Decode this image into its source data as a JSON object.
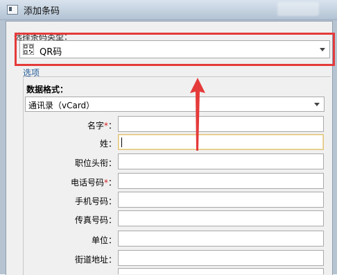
{
  "window": {
    "title": "添加条码"
  },
  "barcode_type": {
    "label": "选择条码类型：",
    "selected": "QR码",
    "icon": "qr-code-icon"
  },
  "options": {
    "section_label": "选项",
    "format_label": "数据格式：",
    "format_selected": "通讯录（vCard）",
    "fields": [
      {
        "label": "名字",
        "required": "*",
        "suffix": "：",
        "value": ""
      },
      {
        "label": "姓",
        "required": "",
        "suffix": "：",
        "value": ""
      },
      {
        "label": "职位头衔",
        "required": "",
        "suffix": "：",
        "value": ""
      },
      {
        "label": "电话号码",
        "required": "*",
        "suffix": "：",
        "value": ""
      },
      {
        "label": "手机号码",
        "required": "",
        "suffix": "：",
        "value": ""
      },
      {
        "label": "传真号码",
        "required": "",
        "suffix": "：",
        "value": ""
      },
      {
        "label": "单位",
        "required": "",
        "suffix": "：",
        "value": ""
      },
      {
        "label": "街道地址",
        "required": "",
        "suffix": "：",
        "value": ""
      }
    ]
  },
  "colors": {
    "highlight": "#e53a3a",
    "required": "#d21f1f",
    "link": "#1f5a96"
  }
}
